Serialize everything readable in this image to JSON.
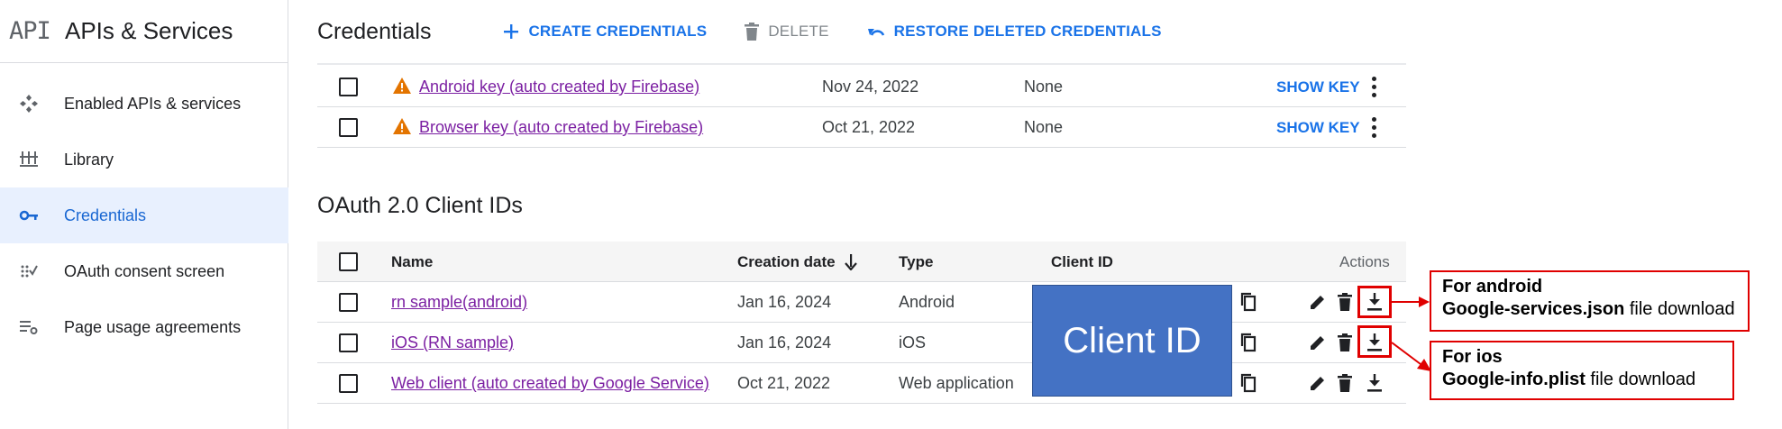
{
  "app": {
    "logo": "API",
    "title": "APIs & Services"
  },
  "sidebar": {
    "items": [
      {
        "label": "Enabled APIs & services",
        "icon": "enabled-apis-icon",
        "active": false
      },
      {
        "label": "Library",
        "icon": "library-icon",
        "active": false
      },
      {
        "label": "Credentials",
        "icon": "key-icon",
        "active": true
      },
      {
        "label": "OAuth consent screen",
        "icon": "oauth-consent-icon",
        "active": false
      },
      {
        "label": "Page usage agreements",
        "icon": "settings-list-icon",
        "active": false
      }
    ]
  },
  "toolbar": {
    "title": "Credentials",
    "create_label": "CREATE CREDENTIALS",
    "delete_label": "DELETE",
    "restore_label": "RESTORE DELETED CREDENTIALS"
  },
  "api_keys": {
    "rows": [
      {
        "name": "Android key (auto created by Firebase)",
        "date": "Nov 24, 2022",
        "restrictions": "None",
        "action": "SHOW KEY"
      },
      {
        "name": "Browser key (auto created by Firebase)",
        "date": "Oct 21, 2022",
        "restrictions": "None",
        "action": "SHOW KEY"
      }
    ]
  },
  "oauth": {
    "title": "OAuth 2.0 Client IDs",
    "columns": {
      "name": "Name",
      "date": "Creation date",
      "type": "Type",
      "client_id": "Client ID",
      "actions": "Actions"
    },
    "rows": [
      {
        "name": "rn sample(android)",
        "date": "Jan 16, 2024",
        "type": "Android"
      },
      {
        "name": "iOS (RN sample)",
        "date": "Jan 16, 2024",
        "type": "iOS"
      },
      {
        "name": "Web client (auto created by Google Service)",
        "date": "Oct 21, 2022",
        "type": "Web application"
      }
    ],
    "client_id_mask": "Client ID"
  },
  "annotations": {
    "android": {
      "line1": "For android",
      "line2_bold": "Google-services.json",
      "line2_rest": " file download"
    },
    "ios": {
      "line1": "For ios",
      "line2_bold": "Google-info.plist",
      "line2_rest": " file download"
    }
  },
  "colors": {
    "accent": "#1a73e8",
    "link": "#7b1fa2",
    "warning": "#e37400",
    "highlight": "#e00000",
    "mask": "#4472c4"
  }
}
